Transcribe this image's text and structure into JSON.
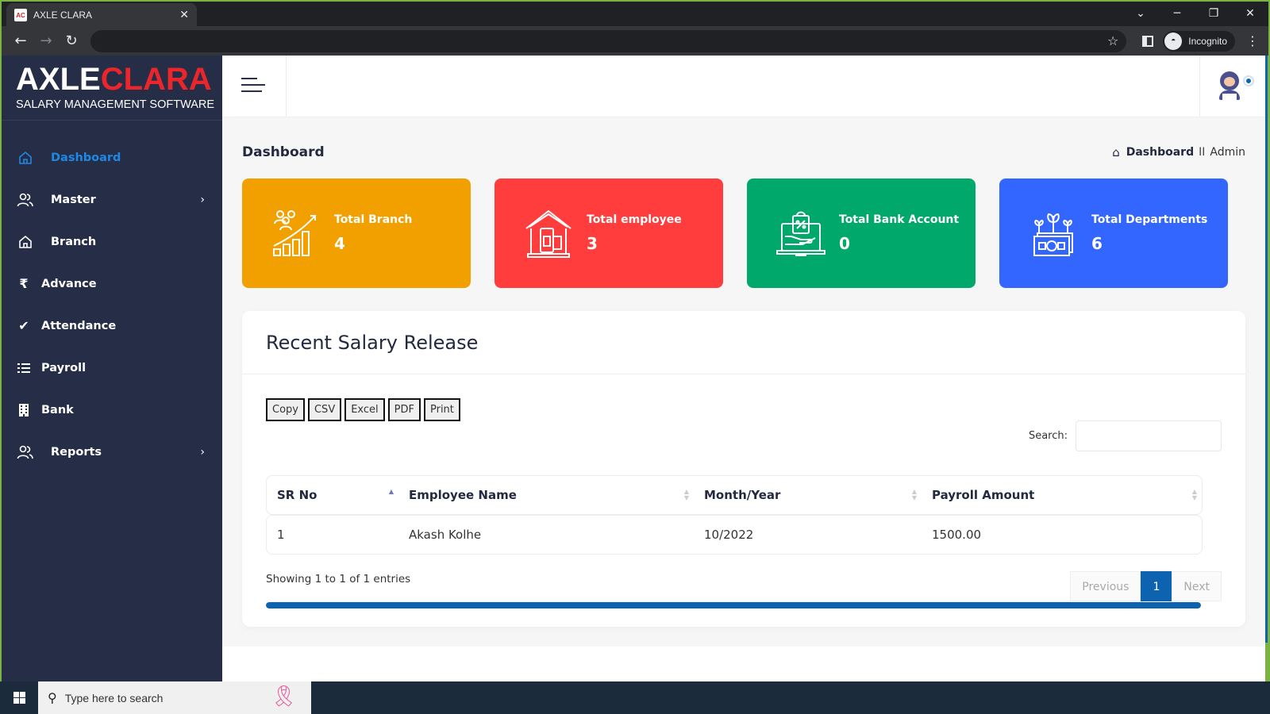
{
  "browser": {
    "tab_title": "AXLE CLARA",
    "favicon_text": "AC",
    "profile_label": "Incognito",
    "url": ""
  },
  "brand": {
    "logo_part1": "AXLE",
    "logo_part2": "CLARA",
    "subtitle": "SALARY MANAGEMENT SOFTWARE"
  },
  "sidebar": {
    "items": [
      {
        "label": "Dashboard",
        "icon": "home-icon",
        "active": true
      },
      {
        "label": "Master",
        "icon": "users-icon",
        "has_submenu": true
      },
      {
        "label": "Branch",
        "icon": "home-icon"
      },
      {
        "label": "Advance",
        "icon": "rupee-icon"
      },
      {
        "label": "Attendance",
        "icon": "check-icon"
      },
      {
        "label": "Payroll",
        "icon": "list-check-icon"
      },
      {
        "label": "Bank",
        "icon": "building-icon"
      },
      {
        "label": "Reports",
        "icon": "users-icon",
        "has_submenu": true
      }
    ]
  },
  "header": {
    "page_title": "Dashboard",
    "breadcrumb": {
      "current": "Dashboard",
      "separator": "II",
      "role": "Admin"
    }
  },
  "cards": [
    {
      "label": "Total Branch",
      "value": "4",
      "color": "#f2a000",
      "icon": "growth-chart-icon"
    },
    {
      "label": "Total employee",
      "value": "3",
      "color": "#ff3d3d",
      "icon": "house-phone-icon"
    },
    {
      "label": "Total Bank Account",
      "value": "0",
      "color": "#00a86b",
      "icon": "laptop-shopping-icon"
    },
    {
      "label": "Total Departments",
      "value": "6",
      "color": "#3366ff",
      "icon": "money-plant-icon"
    }
  ],
  "salary_panel": {
    "title": "Recent Salary Release",
    "export_buttons": [
      "Copy",
      "CSV",
      "Excel",
      "PDF",
      "Print"
    ],
    "search_label": "Search:",
    "search_value": "",
    "columns": [
      "SR No",
      "Employee Name",
      "Month/Year",
      "Payroll Amount"
    ],
    "rows": [
      {
        "sr": "1",
        "name": "Akash Kolhe",
        "month_year": "10/2022",
        "amount": "1500.00"
      }
    ],
    "info": "Showing 1 to 1 of 1 entries",
    "pagination": {
      "previous": "Previous",
      "current": "1",
      "next": "Next"
    },
    "scroll_progress": 1.0
  },
  "taskbar": {
    "search_placeholder": "Type here to search"
  },
  "colors": {
    "sidebar_bg": "#252d47",
    "accent": "#1e88e5",
    "primary": "#0d63b0",
    "logo_red": "#e8262b"
  }
}
